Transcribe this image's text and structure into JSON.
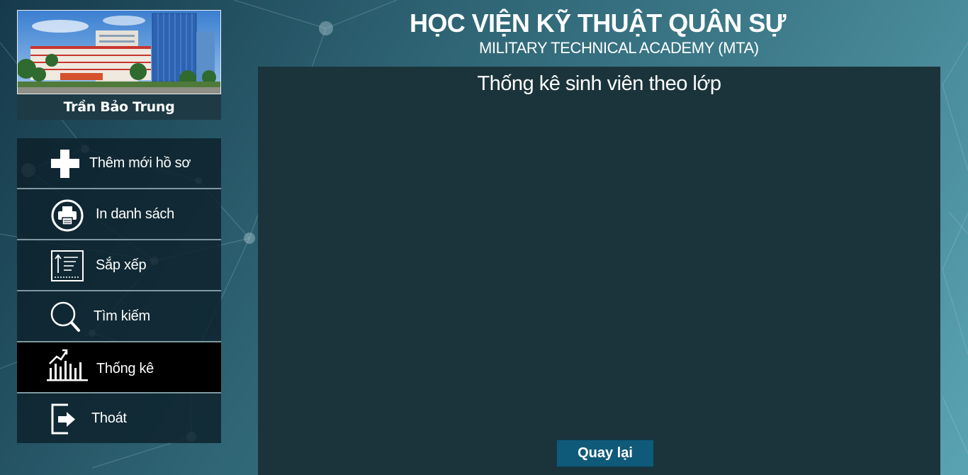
{
  "header": {
    "title": "HỌC VIỆN KỸ THUẬT QUÂN SỰ",
    "subtitle": "MILITARY TECHNICAL ACADEMY (MTA)"
  },
  "profile": {
    "name": "Trần Bảo Trung"
  },
  "menu": {
    "items": [
      {
        "label": "Thêm mới hồ sơ",
        "icon": "plus-icon"
      },
      {
        "label": "In danh sách",
        "icon": "printer-icon"
      },
      {
        "label": "Sắp xếp",
        "icon": "sort-icon"
      },
      {
        "label": "Tìm kiếm",
        "icon": "search-icon"
      },
      {
        "label": "Thống kê",
        "icon": "chart-icon",
        "active": true
      },
      {
        "label": "Thoát",
        "icon": "exit-icon"
      }
    ]
  },
  "panel": {
    "title": "Thống kê sinh viên theo lớp",
    "back_label": "Quay lại"
  },
  "colors": {
    "panel_bg": "#1b343b",
    "menu_bg": "#0c202a",
    "active_bg": "#000000",
    "button_bg": "#0f5a78"
  }
}
